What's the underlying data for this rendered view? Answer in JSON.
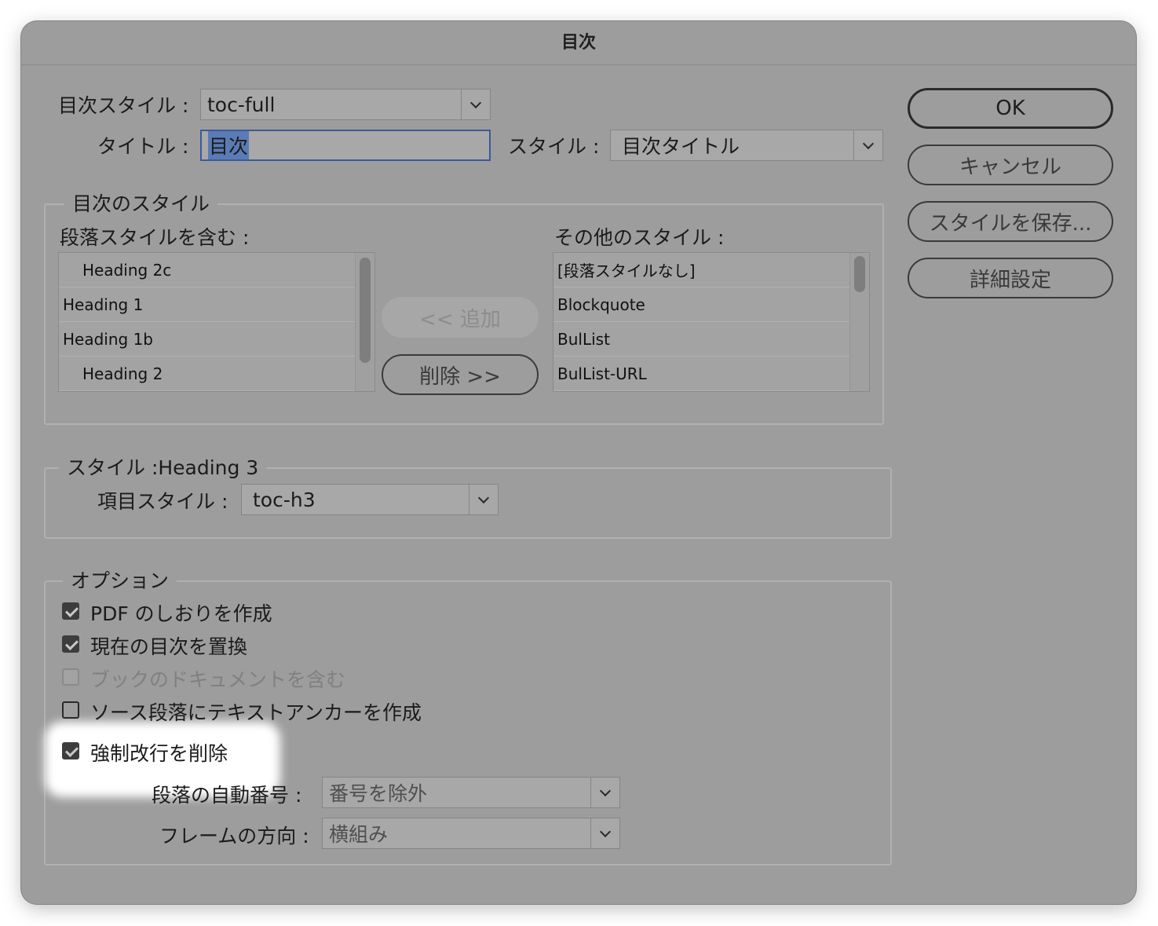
{
  "window": {
    "title": "目次"
  },
  "header": {
    "toc_style_label": "目次スタイル :",
    "toc_style_value": "toc-full",
    "title_label": "タイトル :",
    "title_value": "目次",
    "style_label": "スタイル :",
    "style_value": "目次タイトル"
  },
  "toc_styles": {
    "group_title": "目次のスタイル",
    "include_label": "段落スタイルを含む :",
    "include_items": [
      {
        "label": "Heading 2c",
        "indent": true
      },
      {
        "label": "Heading 1",
        "indent": false
      },
      {
        "label": "Heading 1b",
        "indent": false
      },
      {
        "label": "Heading 2",
        "indent": true
      }
    ],
    "other_label": "その他のスタイル :",
    "other_items": [
      "[段落スタイルなし]",
      "Blockquote",
      "BulList",
      "BulList-URL"
    ],
    "add_button": "<< 追加",
    "remove_button": "削除 >>"
  },
  "style_section": {
    "group_title": "スタイル :Heading 3",
    "entry_style_label": "項目スタイル :",
    "entry_style_value": "toc-h3"
  },
  "options": {
    "group_title": "オプション",
    "items": [
      {
        "label": "PDF のしおりを作成",
        "checked": true,
        "enabled": true
      },
      {
        "label": "現在の目次を置換",
        "checked": true,
        "enabled": true
      },
      {
        "label": "ブックのドキュメントを含む",
        "checked": false,
        "enabled": false
      },
      {
        "label": "ソース段落にテキストアンカーを作成",
        "checked": false,
        "enabled": true
      },
      {
        "label": "強制改行を削除",
        "checked": true,
        "enabled": true
      }
    ],
    "numbering_label": "段落の自動番号 :",
    "numbering_value": "番号を除外",
    "frame_label": "フレームの方向 :",
    "frame_value": "横組み"
  },
  "buttons": {
    "ok": "OK",
    "cancel": "キャンセル",
    "save_style": "スタイルを保存...",
    "more_options": "詳細設定"
  }
}
